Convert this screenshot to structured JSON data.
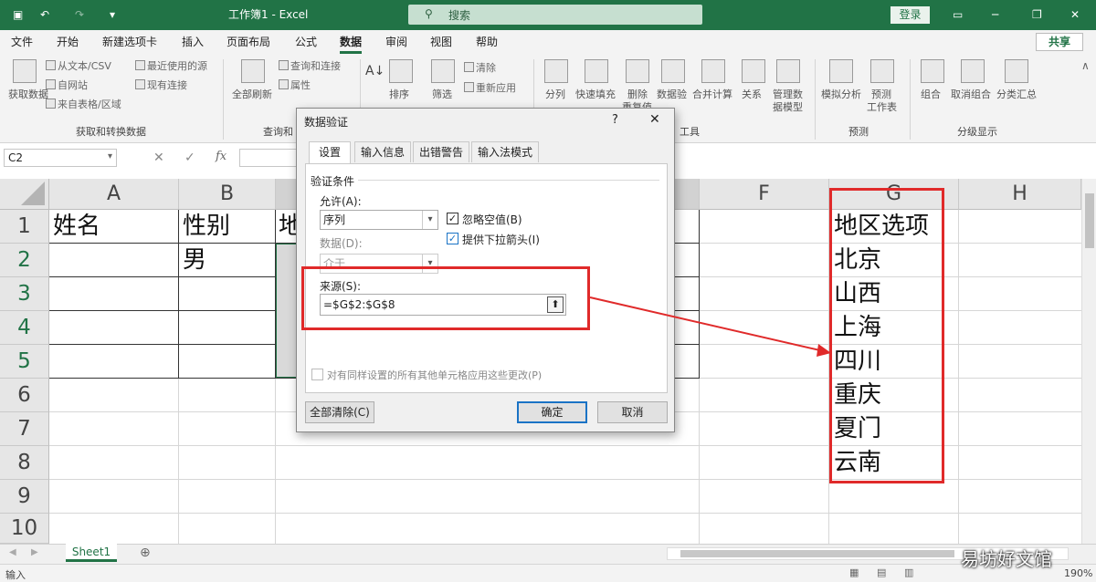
{
  "window": {
    "title": "工作簿1 - Excel",
    "search_placeholder": "搜索",
    "login": "登录"
  },
  "tabs": [
    {
      "label": "文件",
      "active": false
    },
    {
      "label": "开始",
      "active": false
    },
    {
      "label": "新建选项卡",
      "active": false
    },
    {
      "label": "插入",
      "active": false
    },
    {
      "label": "页面布局",
      "active": false
    },
    {
      "label": "公式",
      "active": false
    },
    {
      "label": "数据",
      "active": true
    },
    {
      "label": "审阅",
      "active": false
    },
    {
      "label": "视图",
      "active": false
    },
    {
      "label": "帮助",
      "active": false
    }
  ],
  "share": "共享",
  "ribbon": {
    "get_data": "获取数据",
    "from_text_csv": "从文本/CSV",
    "from_web": "自网站",
    "from_table": "来自表格/区域",
    "recent_sources": "最近使用的源",
    "existing_connections": "现有连接",
    "group_get_transform": "获取和转换数据",
    "refresh_all": "全部刷新",
    "queries_connections": "查询和连接",
    "properties": "属性",
    "group_queries": "查询和",
    "sort": "排序",
    "filter": "筛选",
    "clear": "清除",
    "reapply": "重新应用",
    "text_to_columns": "分列",
    "flash_fill": "快速填充",
    "remove_duplicates": "删除",
    "remove_duplicates2": "重复值",
    "data_validation": "数据验",
    "consolidate": "合并计算",
    "relationships": "关系",
    "manage_data_model": "管理数",
    "manage_data_model2": "据模型",
    "group_tools": "工具",
    "what_if": "模拟分析",
    "forecast_sheet": "预测",
    "forecast_sheet2": "工作表",
    "group_forecast": "预测",
    "group_outline_items": [
      "组合",
      "取消组合",
      "分类汇总"
    ],
    "group_outline": "分级显示"
  },
  "formula_bar": {
    "name_box": "C2",
    "fx": "fx"
  },
  "columns": [
    "A",
    "B",
    "F",
    "G",
    "H"
  ],
  "rows": [
    "1",
    "2",
    "3",
    "4",
    "5",
    "6",
    "7",
    "8",
    "9",
    "10"
  ],
  "cells": {
    "A1": "姓名",
    "B1": "性别",
    "B2": "男",
    "C1": "地",
    "G1": "地区选项",
    "G2": "北京",
    "G3": "山西",
    "G4": "上海",
    "G5": "四川",
    "G6": "重庆",
    "G7": "夏门",
    "G8": "云南"
  },
  "sheet": {
    "tab": "Sheet1",
    "status": "输入",
    "zoom": "190%"
  },
  "dialog": {
    "title": "数据验证",
    "help": "?",
    "close": "✕",
    "tabs": [
      "设置",
      "输入信息",
      "出错警告",
      "输入法模式"
    ],
    "section": "验证条件",
    "allow_label": "允许(A):",
    "allow_value": "序列",
    "ignore_blank": "忽略空值(B)",
    "ignore_blank_checked": true,
    "dropdown": "提供下拉箭头(I)",
    "dropdown_checked": true,
    "data_label": "数据(D):",
    "data_value": "介于",
    "source_label": "来源(S):",
    "source_value": "=$G$2:$G$8",
    "apply_all": "对有同样设置的所有其他单元格应用这些更改(P)",
    "clear_all": "全部清除(C)",
    "ok": "确定",
    "cancel": "取消"
  },
  "watermark": "易坊好文馆",
  "colors": {
    "excel_green": "#217346",
    "highlight_red": "#e02a2a",
    "selected_cell": "#d9d9d9"
  }
}
